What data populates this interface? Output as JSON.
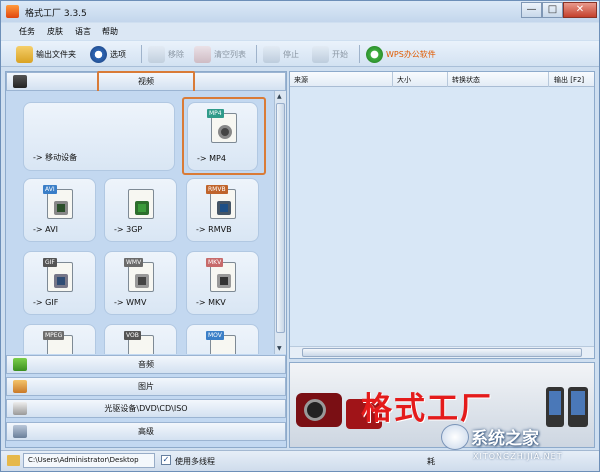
{
  "window": {
    "title": "格式工厂 3.3.5",
    "min_glyph": "—",
    "max_glyph": "□",
    "close_glyph": "✕"
  },
  "menu": [
    "任务",
    "皮肤",
    "语言",
    "帮助"
  ],
  "toolbar": {
    "output_folder": "输出文件夹",
    "options": "选项",
    "remove": "移除",
    "clear_list": "清空列表",
    "stop": "停止",
    "start": "开始",
    "wps": "WPS办公软件"
  },
  "left": {
    "categories": {
      "video": "视频",
      "audio": "音频",
      "image": "图片",
      "disc": "光驱设备\\DVD\\CD\\ISO",
      "advanced": "高级"
    },
    "cards": [
      {
        "label": "-> 移动设备",
        "badge": ""
      },
      {
        "label": "-> MP4",
        "badge": "MP4"
      },
      {
        "label": "-> AVI",
        "badge": "AVI"
      },
      {
        "label": "-> 3GP",
        "badge": ""
      },
      {
        "label": "-> RMVB",
        "badge": "RMVB"
      },
      {
        "label": "-> GIF",
        "badge": "GIF"
      },
      {
        "label": "-> WMV",
        "badge": "WMV"
      },
      {
        "label": "-> MKV",
        "badge": "MKV"
      },
      {
        "label": "",
        "badge": "MPEG"
      },
      {
        "label": "",
        "badge": "VOB"
      },
      {
        "label": "",
        "badge": "MOV"
      }
    ],
    "scroll_up": "▲",
    "scroll_down": "▼"
  },
  "list_header": {
    "source": "来源",
    "size": "大小",
    "status": "转换状态",
    "output": "输出 [F2]"
  },
  "banner": {
    "text": "格式工厂"
  },
  "status": {
    "path": "C:\\Users\\Administrator\\Desktop",
    "multithread_checked": true,
    "check_glyph": "✓",
    "multithread_label": "使用多线程",
    "elapsed_label": "耗"
  },
  "watermark": {
    "title": "系统之家",
    "url": "XITONGZHIJIA.NET"
  },
  "colors": {
    "highlight": "#d97b37",
    "banner_red": "#e41b1b",
    "wps_orange": "#e05a00"
  }
}
